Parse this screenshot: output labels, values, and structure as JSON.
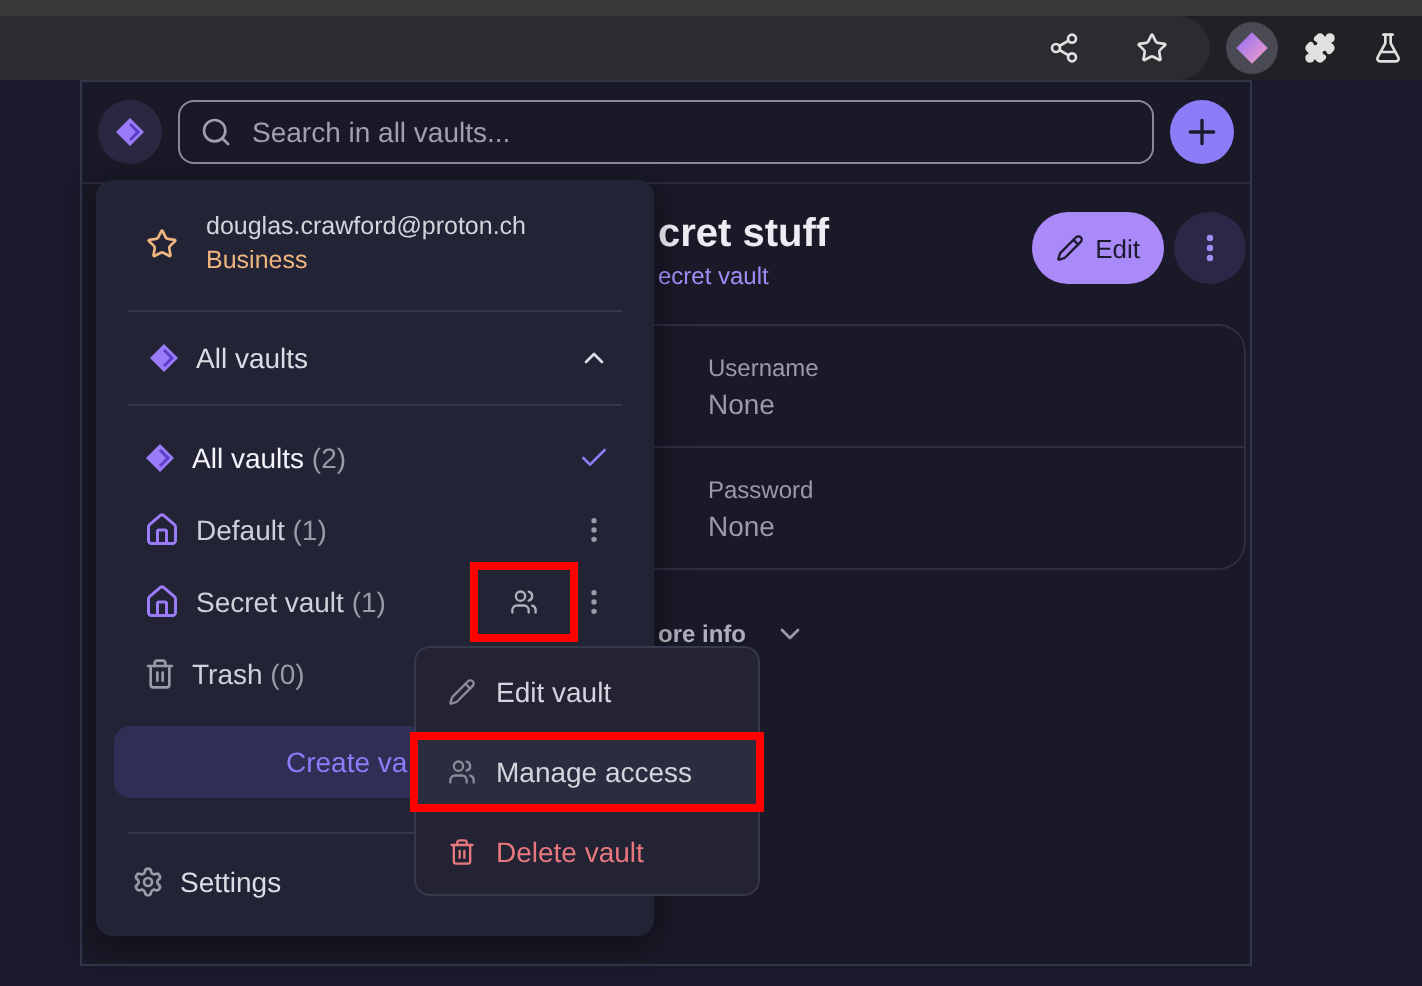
{
  "search": {
    "placeholder": "Search in all vaults..."
  },
  "detail": {
    "title": "cret stuff",
    "vault": "ecret vault",
    "edit_label": "Edit",
    "fields": [
      {
        "label": "Username",
        "value": "None"
      },
      {
        "label": "Password",
        "value": "None"
      }
    ],
    "more_info": "ore info"
  },
  "menu": {
    "account": {
      "email": "douglas.crawford@proton.ch",
      "plan": "Business"
    },
    "filter": {
      "label": "All vaults",
      "expanded": true
    },
    "vaults": [
      {
        "kind": "all",
        "label": "All vaults",
        "count": "(2)",
        "selected": true
      },
      {
        "kind": "vault",
        "label": "Default",
        "count": "(1)",
        "selected": false
      },
      {
        "kind": "vault",
        "label": "Secret vault",
        "count": "(1)",
        "selected": false,
        "share_icon": {
          "annotated": true
        }
      },
      {
        "kind": "trash",
        "label": "Trash",
        "count": "(0)",
        "selected": false
      }
    ],
    "create_label": "Create va",
    "settings_label": "Settings"
  },
  "context_menu": [
    {
      "kind": "edit",
      "label": "Edit vault",
      "highlighted": false,
      "annotated": false
    },
    {
      "kind": "access",
      "label": "Manage access",
      "highlighted": true,
      "annotated": true
    },
    {
      "kind": "delete",
      "label": "Delete vault",
      "highlighted": false,
      "annotated": false
    }
  ]
}
